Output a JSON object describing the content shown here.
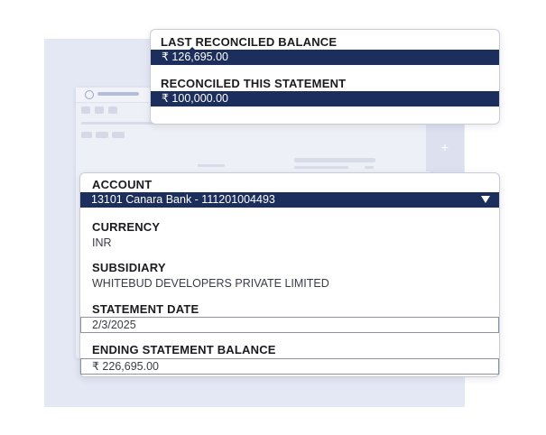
{
  "reconcile": {
    "last_reconciled_label": "LAST RECONCILED BALANCE",
    "last_reconciled_value": "₹ 126,695.00",
    "reconciled_this_label": "RECONCILED THIS STATEMENT",
    "reconciled_this_value": "₹ 100,000.00"
  },
  "form": {
    "account_label": "ACCOUNT",
    "account_value": "13101 Canara Bank - 111201004493",
    "currency_label": "CURRENCY",
    "currency_value": "INR",
    "subsidiary_label": "SUBSIDIARY",
    "subsidiary_value": "WHITEBUD DEVELOPERS PRIVATE LIMITED",
    "statement_date_label": "STATEMENT DATE",
    "statement_date_value": "2/3/2025",
    "ending_balance_label": "ENDING STATEMENT BALANCE",
    "ending_balance_value": "₹ 226,695.00"
  },
  "icons": {
    "dropdown": "chevron-down-icon",
    "plus": "plus-icon",
    "logo": "logo-icon"
  },
  "colors": {
    "highlight": "#1c2e5c",
    "background_panel": "#e4e7f4"
  }
}
